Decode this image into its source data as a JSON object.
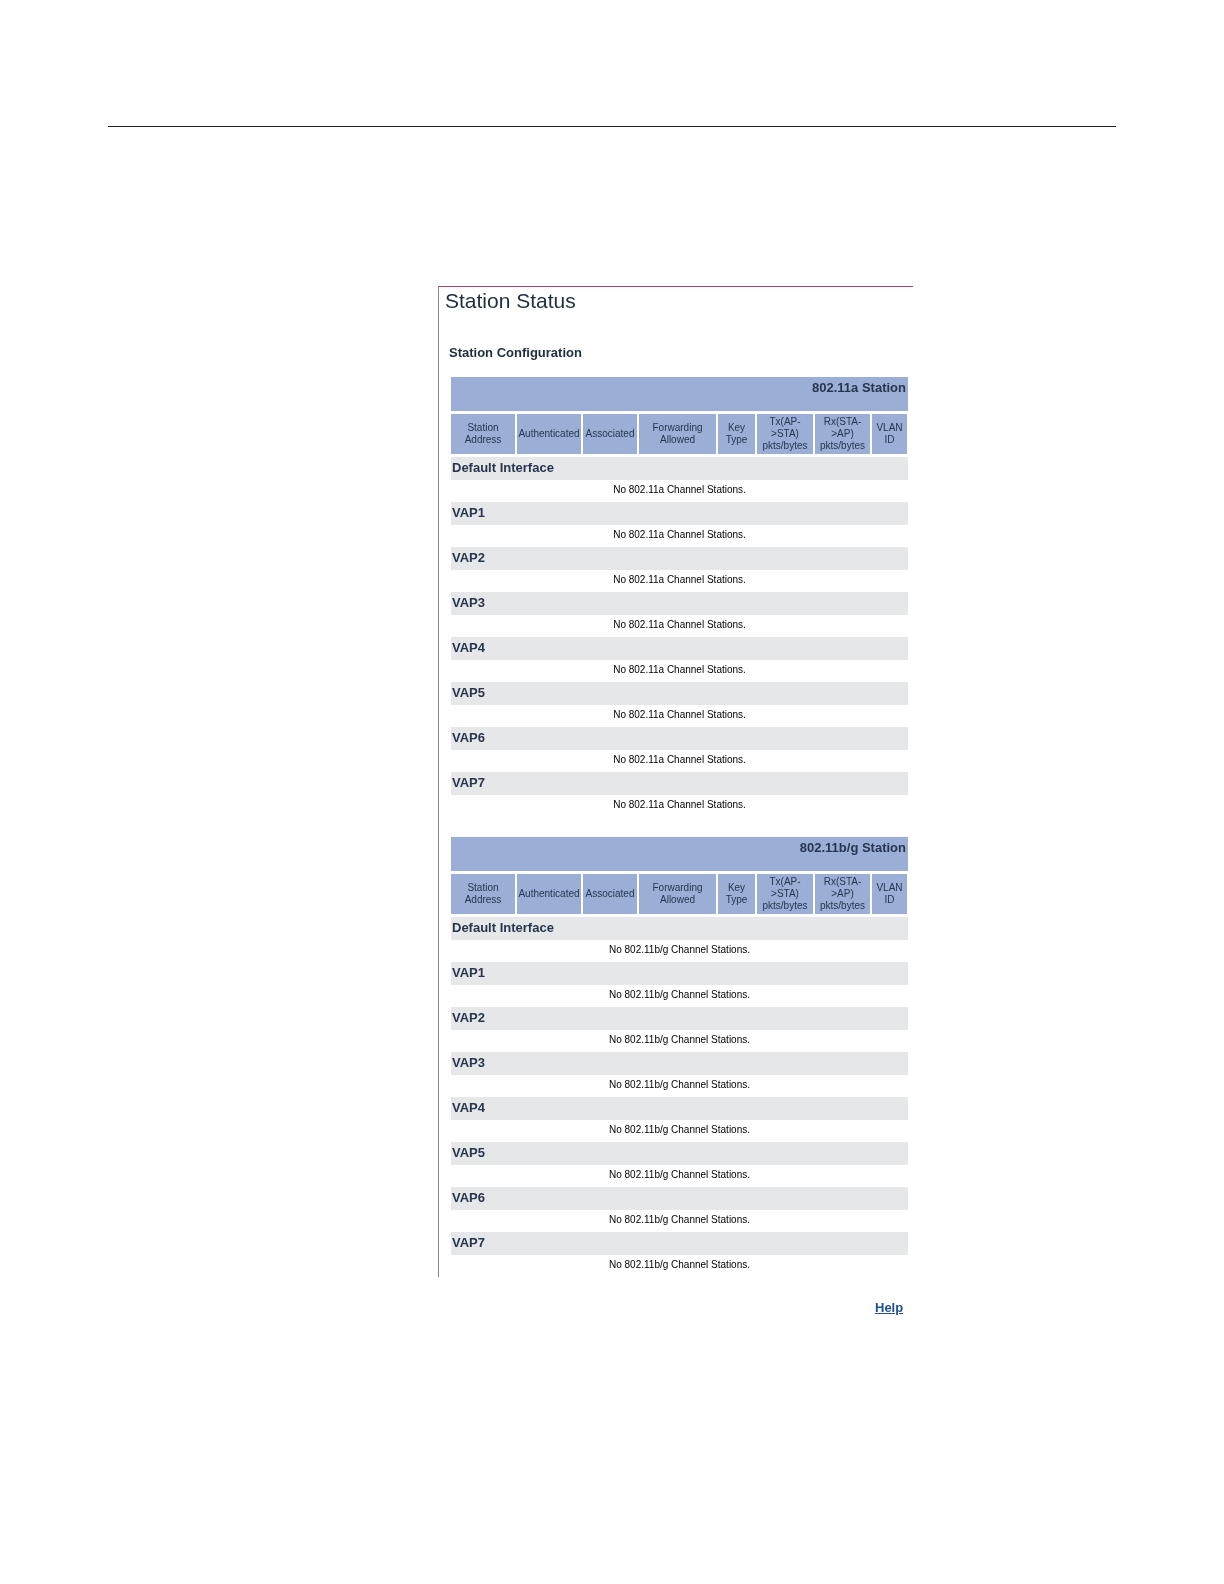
{
  "page_title": "Station Status",
  "subtitle": "Station Configuration",
  "sections": [
    {
      "title": "802.11a Station",
      "columns": [
        "Station Address",
        "Authenticated",
        "Associated",
        "Forwarding Allowed",
        "Key Type",
        "Tx(AP- >STA) pkts/bytes",
        "Rx(STA- >AP) pkts/bytes",
        "VLAN ID"
      ],
      "groups": [
        {
          "name": "Default Interface",
          "message": "No 802.11a Channel Stations."
        },
        {
          "name": "VAP1",
          "message": "No 802.11a Channel Stations."
        },
        {
          "name": "VAP2",
          "message": "No 802.11a Channel Stations."
        },
        {
          "name": "VAP3",
          "message": "No 802.11a Channel Stations."
        },
        {
          "name": "VAP4",
          "message": "No 802.11a Channel Stations."
        },
        {
          "name": "VAP5",
          "message": "No 802.11a Channel Stations."
        },
        {
          "name": "VAP6",
          "message": "No 802.11a Channel Stations."
        },
        {
          "name": "VAP7",
          "message": "No 802.11a Channel Stations."
        }
      ]
    },
    {
      "title": "802.11b/g Station",
      "columns": [
        "Station Address",
        "Authenticated",
        "Associated",
        "Forwarding Allowed",
        "Key Type",
        "Tx(AP- >STA) pkts/bytes",
        "Rx(STA- >AP) pkts/bytes",
        "VLAN ID"
      ],
      "groups": [
        {
          "name": "Default Interface",
          "message": "No 802.11b/g Channel Stations."
        },
        {
          "name": "VAP1",
          "message": "No 802.11b/g Channel Stations."
        },
        {
          "name": "VAP2",
          "message": "No 802.11b/g Channel Stations."
        },
        {
          "name": "VAP3",
          "message": "No 802.11b/g Channel Stations."
        },
        {
          "name": "VAP4",
          "message": "No 802.11b/g Channel Stations."
        },
        {
          "name": "VAP5",
          "message": "No 802.11b/g Channel Stations."
        },
        {
          "name": "VAP6",
          "message": "No 802.11b/g Channel Stations."
        },
        {
          "name": "VAP7",
          "message": "No 802.11b/g Channel Stations."
        }
      ]
    }
  ],
  "help_link": "Help"
}
